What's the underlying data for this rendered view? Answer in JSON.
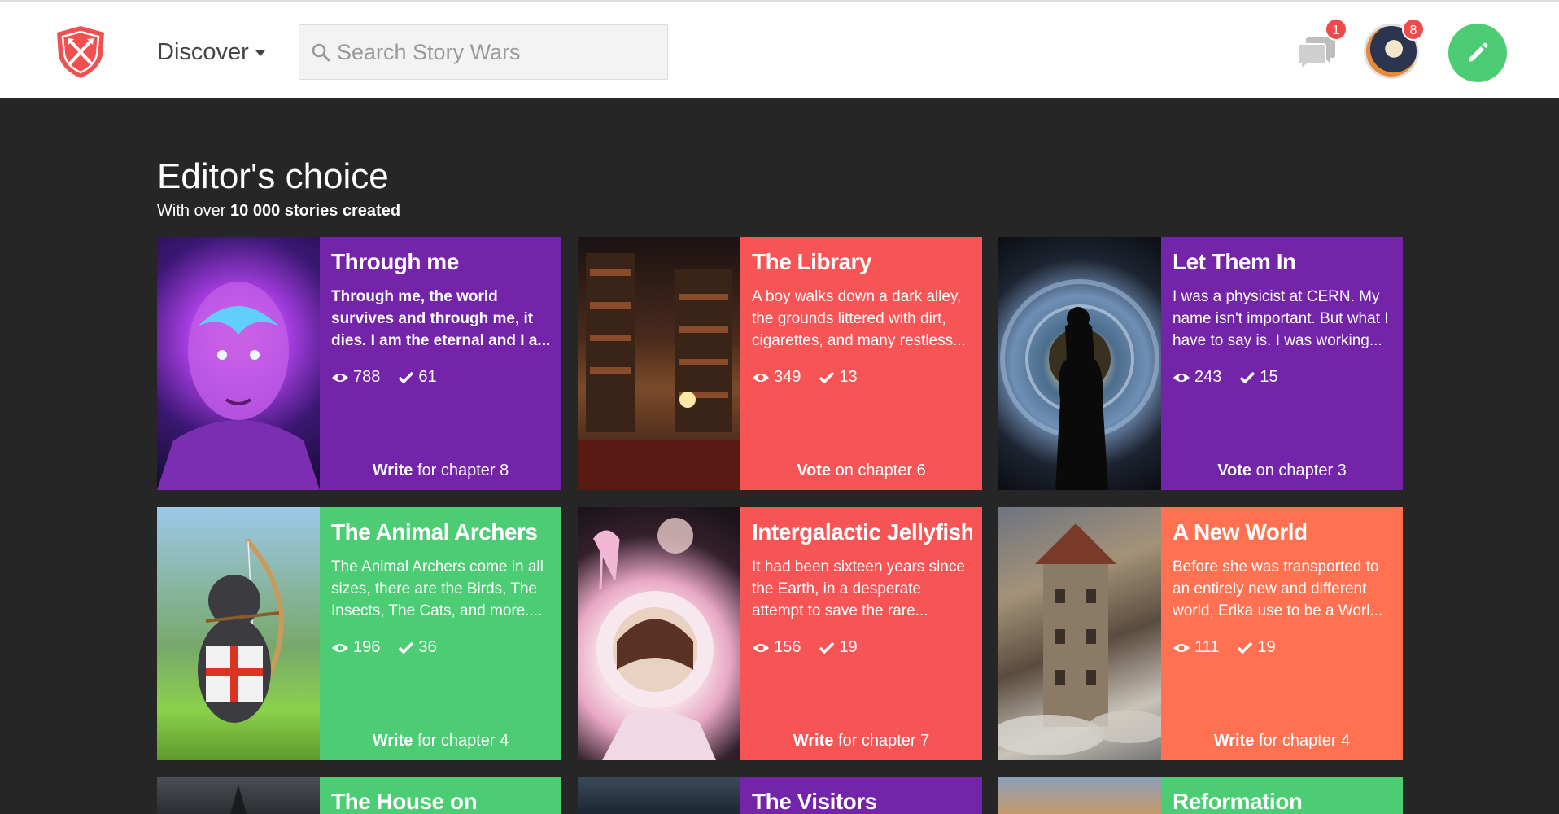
{
  "header": {
    "discover_label": "Discover",
    "search_placeholder": "Search Story Wars",
    "messages_badge": "1",
    "profile_badge": "8"
  },
  "colors": {
    "purple": "#7424a8",
    "red": "#f75455",
    "green": "#4ccd73",
    "orange": "#ff7150",
    "badge": "#f04a4a"
  },
  "section": {
    "title": "Editor's choice",
    "subtitle_prefix": "With over",
    "subtitle_bold": "10 000 stories created"
  },
  "cards": [
    {
      "title": "Through me",
      "excerpt": "Through me, the world survives and through me, it dies. I am the eternal and I a...",
      "views": "788",
      "votes": "61",
      "cta_action": "Write",
      "cta_text": "for chapter 8"
    },
    {
      "title": "The Library",
      "excerpt": "A boy walks down a dark alley, the grounds littered with dirt, cigarettes, and many restless...",
      "views": "349",
      "votes": "13",
      "cta_action": "Vote",
      "cta_text": "on chapter 6"
    },
    {
      "title": "Let Them In",
      "excerpt": "I was a physicist at CERN. My name isn't important. But what I have to say is. I was working...",
      "views": "243",
      "votes": "15",
      "cta_action": "Vote",
      "cta_text": "on chapter 3"
    },
    {
      "title": "The Animal Archers",
      "excerpt": "The Animal Archers come in all sizes, there are the Birds, The Insects, The Cats, and more....",
      "views": "196",
      "votes": "36",
      "cta_action": "Write",
      "cta_text": "for chapter 4"
    },
    {
      "title": "Intergalactic Jellyfish",
      "excerpt": "It had been sixteen years since the Earth, in a desperate attempt to save the rare...",
      "views": "156",
      "votes": "19",
      "cta_action": "Write",
      "cta_text": "for chapter 7"
    },
    {
      "title": "A New World",
      "excerpt": "Before she was transported to an entirely new and different world, Erika use to be a Worl...",
      "views": "111",
      "votes": "19",
      "cta_action": "Write",
      "cta_text": "for chapter 4"
    },
    {
      "title": "The House on"
    },
    {
      "title": "The Visitors"
    },
    {
      "title": "Reformation"
    }
  ]
}
